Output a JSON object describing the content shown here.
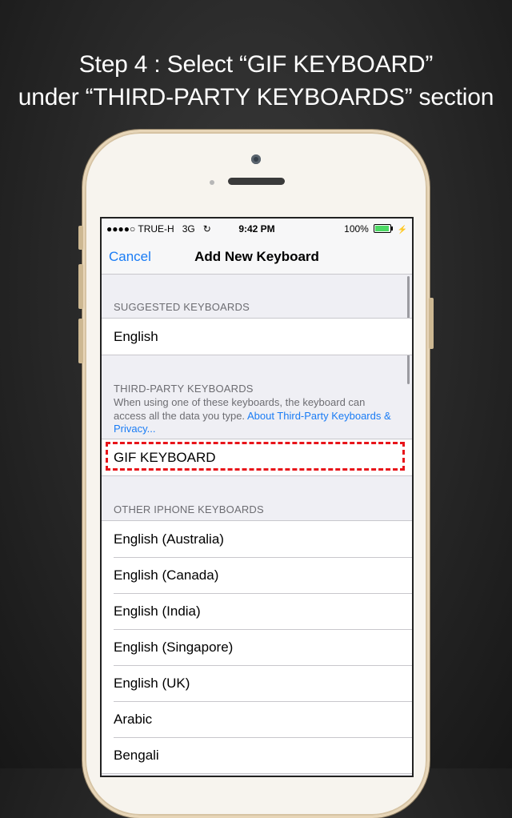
{
  "headline": {
    "line1": "Step 4 : Select “GIF KEYBOARD”",
    "line2": "under “THIRD-PARTY KEYBOARDS” section"
  },
  "status_bar": {
    "signal": "●●●●○",
    "carrier": "TRUE-H",
    "network": "3G",
    "sync_icon": "↻",
    "time": "9:42 PM",
    "battery_percent": "100%",
    "battery_level": 1.0,
    "charging_icon": "⚡"
  },
  "nav": {
    "cancel_label": "Cancel",
    "title": "Add New Keyboard"
  },
  "suggested": {
    "header": "SUGGESTED KEYBOARDS",
    "items": [
      "English"
    ]
  },
  "third_party": {
    "header": "THIRD-PARTY KEYBOARDS",
    "note": "When using one of these keyboards, the keyboard can access all the data you type.",
    "link": "About Third-Party Keyboards & Privacy...",
    "items": [
      "GIF KEYBOARD"
    ]
  },
  "other": {
    "header": "OTHER IPHONE KEYBOARDS",
    "items": [
      "English (Australia)",
      "English (Canada)",
      "English (India)",
      "English (Singapore)",
      "English (UK)",
      "Arabic",
      "Bengali"
    ]
  },
  "colors": {
    "accent": "#1a7cf5",
    "highlight": "#e8141a",
    "battery": "#4cd964"
  }
}
